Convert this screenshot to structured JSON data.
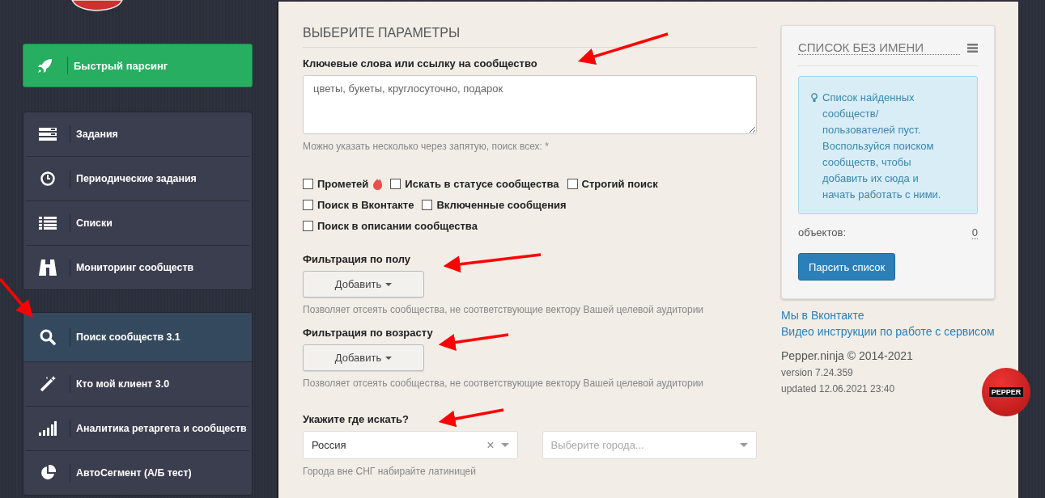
{
  "sidebar": {
    "quick_action": {
      "label": "Быстрый парсинг"
    },
    "menu_groups": [
      {
        "items": [
          {
            "label": "Задания",
            "selected": false
          },
          {
            "label": "Периодические задания",
            "selected": false
          },
          {
            "label": "Списки",
            "selected": false
          },
          {
            "label": "Мониторинг сообществ",
            "selected": false
          }
        ]
      },
      {
        "items": [
          {
            "label": "Поиск сообществ 3.1",
            "selected": true
          },
          {
            "label": "Кто мой клиент 3.0",
            "selected": false
          },
          {
            "label": "Аналитика ретаргета и сообществ",
            "selected": false
          },
          {
            "label": "АвтоСегмент (А/Б тест)",
            "selected": false
          }
        ]
      }
    ]
  },
  "form": {
    "title": "ВЫБЕРИТЕ ПАРАМЕТРЫ",
    "keywords": {
      "label": "Ключевые слова или ссылку на сообщество",
      "placeholder": "цветы, букеты, круглосуточно, подарок",
      "hint": "Можно указать несколько через запятую, поиск всех: *"
    },
    "options": [
      [
        {
          "label": "Прометей",
          "checked": false,
          "hot": true
        },
        {
          "label": "Искать в статусе сообщества",
          "checked": false,
          "hot": false
        },
        {
          "label": "Строгий поиск",
          "checked": false,
          "hot": false
        }
      ],
      [
        {
          "label": "Поиск в Вконтакте",
          "checked": false,
          "hot": false
        },
        {
          "label": "Включенные сообщения",
          "checked": false,
          "hot": false
        }
      ],
      [
        {
          "label": "Поиск в описании сообщества",
          "checked": false,
          "hot": false
        }
      ]
    ],
    "filters": [
      {
        "label": "Фильтрация по полу",
        "button": "Добавить",
        "hint": "Позволяет отсеять сообщества, не соответствующие вектору Вашей целевой аудитории"
      },
      {
        "label": "Фильтрация по возрасту",
        "button": "Добавить",
        "hint": "Позволяет отсеять сообщества, не соответствующие вектору Вашей целевой аудитории"
      }
    ],
    "location": {
      "label": "Укажите где искать?",
      "country": {
        "value": "Россия",
        "clear": "×"
      },
      "city": {
        "placeholder": "Выберите города..."
      },
      "hint": "Города вне СНГ набирайте латиницей"
    }
  },
  "list_card": {
    "title": "СПИСОК БЕЗ ИМЕНИ",
    "info": "Список найденных сообществ/ пользователей пуст. Воспользуйся поиском сообществ, чтобы добавить их сюда и начать работать с ними.",
    "count_label": "объектов:",
    "count": "0",
    "button": "Парсить список"
  },
  "links": [
    "Мы в Вконтакте",
    "Видео инструкции по работе с сервисом"
  ],
  "footer": {
    "copyright": "Pepper.ninja © 2014-2021",
    "version": "version 7.24.359",
    "updated": "updated 12.06.2021 23:40"
  },
  "badge": {
    "label": "PEPPER"
  }
}
